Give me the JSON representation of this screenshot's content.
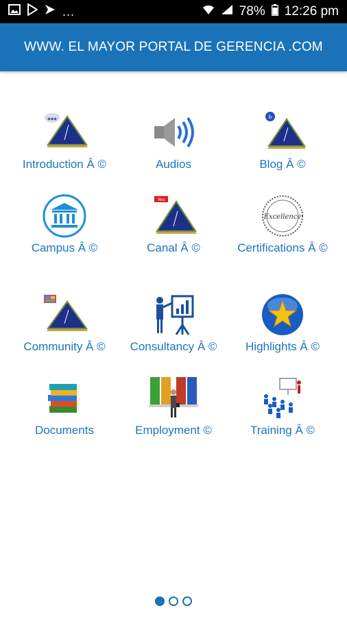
{
  "status_bar": {
    "left_icons": [
      "image-icon",
      "play-store-icon",
      "play-games-icon"
    ],
    "more": "...",
    "battery": "78%",
    "time": "12:26 pm"
  },
  "header": {
    "title": "WWW. EL MAYOR PORTAL DE GERENCIA .COM"
  },
  "colors": {
    "accent": "#1a73b8",
    "label": "#1e73be",
    "status_bar": "#000000"
  },
  "grid": [
    {
      "label": "Introduction Â ©",
      "icon": "pyramid-network-icon"
    },
    {
      "label": "Audios",
      "icon": "speaker-icon"
    },
    {
      "label": "Blog Â ©",
      "icon": "pyramid-blog-icon"
    },
    {
      "label": "Campus Â ©",
      "icon": "campus-building-icon"
    },
    {
      "label": "Canal Â ©",
      "icon": "pyramid-youtube-icon"
    },
    {
      "label": "Certifications Â ©",
      "icon": "certificate-seal-icon"
    },
    {
      "label": "Community Â ©",
      "icon": "pyramid-community-icon"
    },
    {
      "label": "Consultancy Â ©",
      "icon": "presentation-board-icon"
    },
    {
      "label": "Highlights Â ©",
      "icon": "star-orb-icon"
    },
    {
      "label": "Documents",
      "icon": "books-icon"
    },
    {
      "label": "Employment ©",
      "icon": "doors-businessman-icon"
    },
    {
      "label": "Training Â ©",
      "icon": "training-audience-icon"
    }
  ],
  "pager": {
    "pages": 3,
    "current": 1
  }
}
